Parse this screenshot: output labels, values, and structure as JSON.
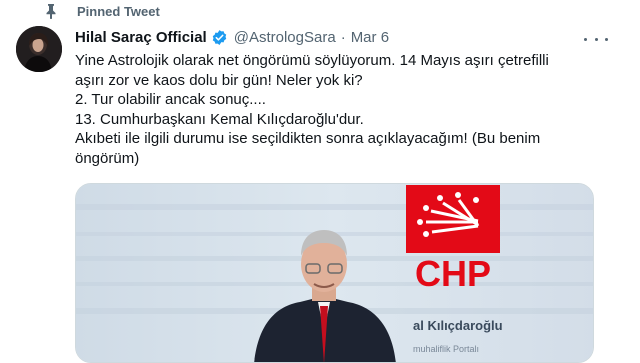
{
  "pinned": {
    "label": "Pinned Tweet",
    "icon": "pin-icon"
  },
  "tweet": {
    "display_name": "Hilal Saraç Official",
    "handle": "@AstrologSara",
    "separator": "·",
    "date": "Mar 6",
    "verified_icon": "verified-badge-icon",
    "text_lines": [
      "Yine Astrolojik olarak net öngörümü söylüyorum. 14 Mayıs aşırı çetrefilli",
      "aşırı zor ve kaos dolu bir gün! Neler yok ki?",
      "2. Tur olabilir ancak sonuç....",
      "13. Cumhurbaşkanı Kemal Kılıçdaroğlu'dur.",
      "Akıbeti ile ilgili durumu ise seçildikten sonra açıklayacağım! (Bu benim",
      "öngörüm)"
    ]
  },
  "media": {
    "logo_text": "CHP",
    "banner_text": "al Kılıçdaroğlu",
    "banner_subtext": "muhaliflik Portalı"
  },
  "colors": {
    "accent": "#1d9bf0",
    "chp_red": "#e30a17",
    "muted": "#536471"
  }
}
